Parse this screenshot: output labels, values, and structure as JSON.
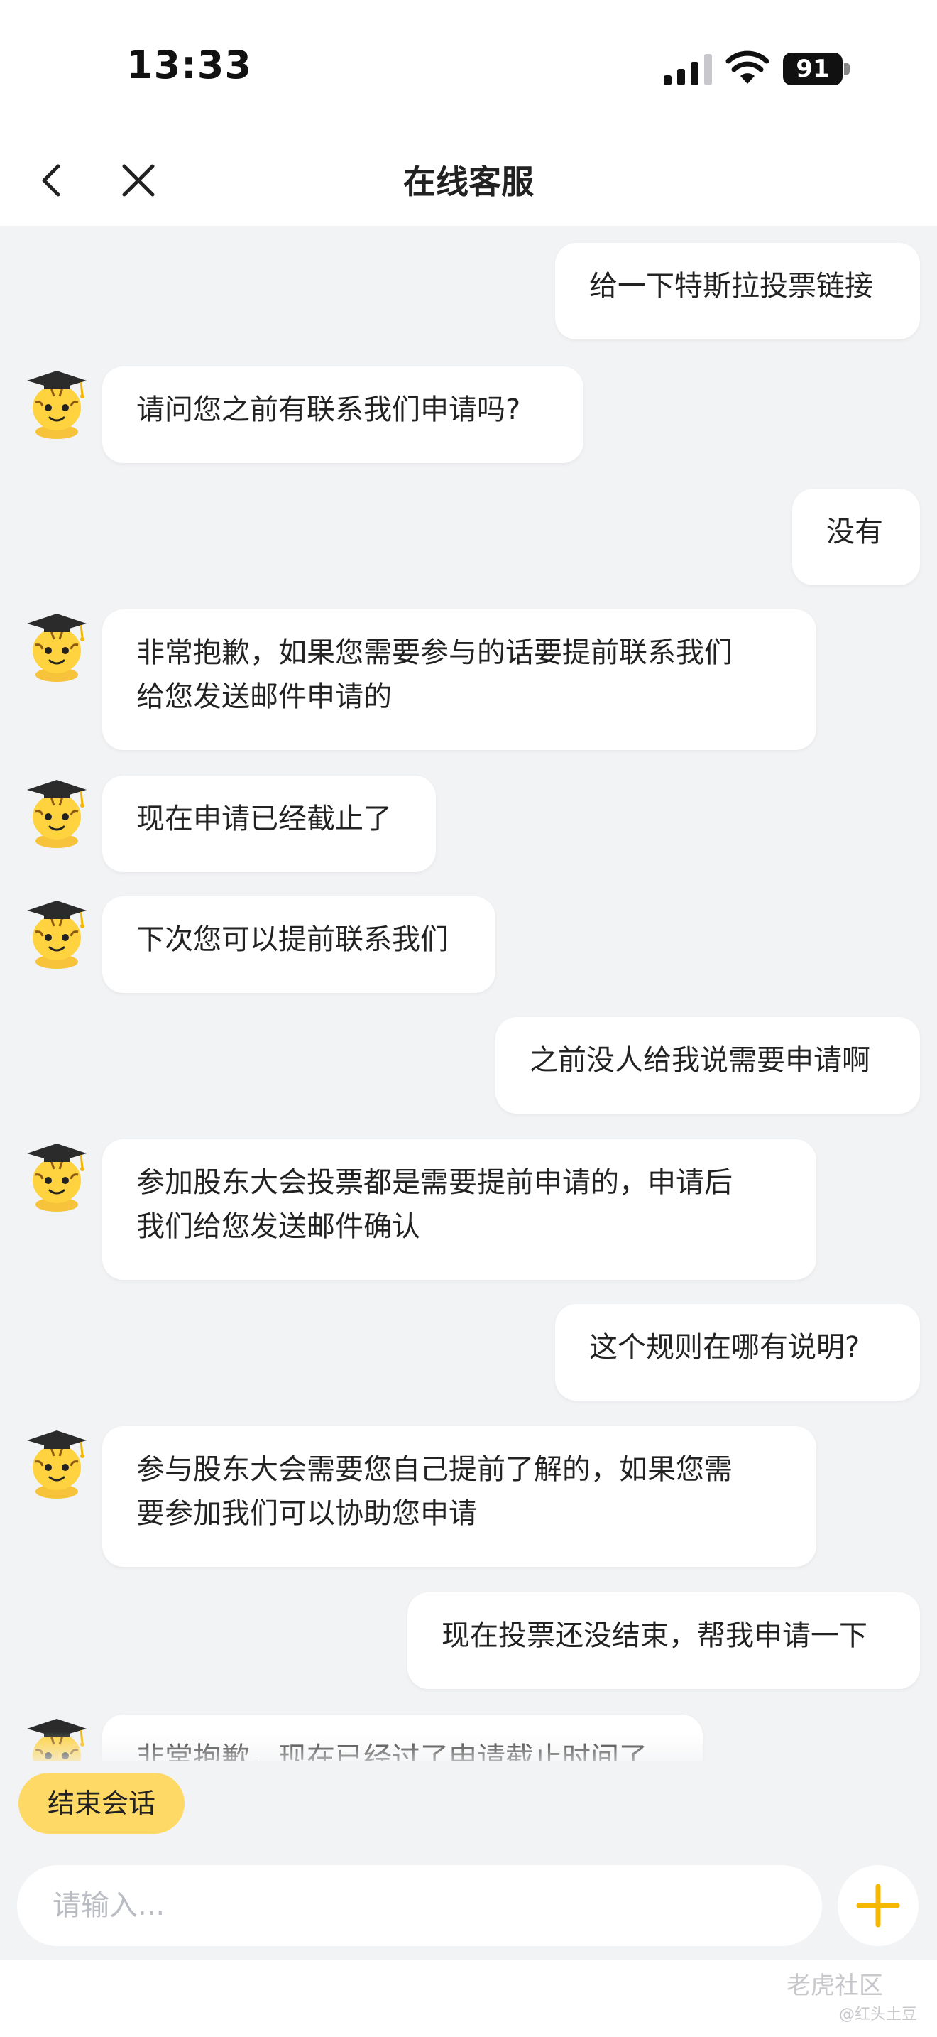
{
  "status_bar": {
    "time": "13:33",
    "battery": "91"
  },
  "nav": {
    "title": "在线客服",
    "back_icon": "chevron-left-icon",
    "close_icon": "close-icon"
  },
  "messages": [
    {
      "from": "user",
      "text": "给一下特斯拉投票链接"
    },
    {
      "from": "agent",
      "text": "请问您之前有联系我们申请吗?"
    },
    {
      "from": "user",
      "text": "没有"
    },
    {
      "from": "agent",
      "text": "非常抱歉，如果您需要参与的话要提前联系我们\n给您发送邮件申请的"
    },
    {
      "from": "agent",
      "text": "现在申请已经截止了"
    },
    {
      "from": "agent",
      "text": "下次您可以提前联系我们"
    },
    {
      "from": "user",
      "text": "之前没人给我说需要申请啊"
    },
    {
      "from": "agent",
      "text": "参加股东大会投票都是需要提前申请的，申请后\n我们给您发送邮件确认"
    },
    {
      "from": "user",
      "text": "这个规则在哪有说明?"
    },
    {
      "from": "agent",
      "text": "参与股东大会需要您自己提前了解的，如果您需\n要参加我们可以协助您申请"
    },
    {
      "from": "user",
      "text": "现在投票还没结束，帮我申请一下"
    },
    {
      "from": "agent",
      "text": "非常抱歉，现在已经过了申请截止时间了"
    }
  ],
  "actions": {
    "end_label": "结束会话"
  },
  "composer": {
    "placeholder": "请输入...",
    "plus_icon": "plus-icon"
  },
  "watermark": {
    "brand": "老虎社区",
    "user": "@红头土豆"
  },
  "colors": {
    "accent": "#ffd966",
    "plus": "#f5b800",
    "background": "#f2f3f5"
  }
}
